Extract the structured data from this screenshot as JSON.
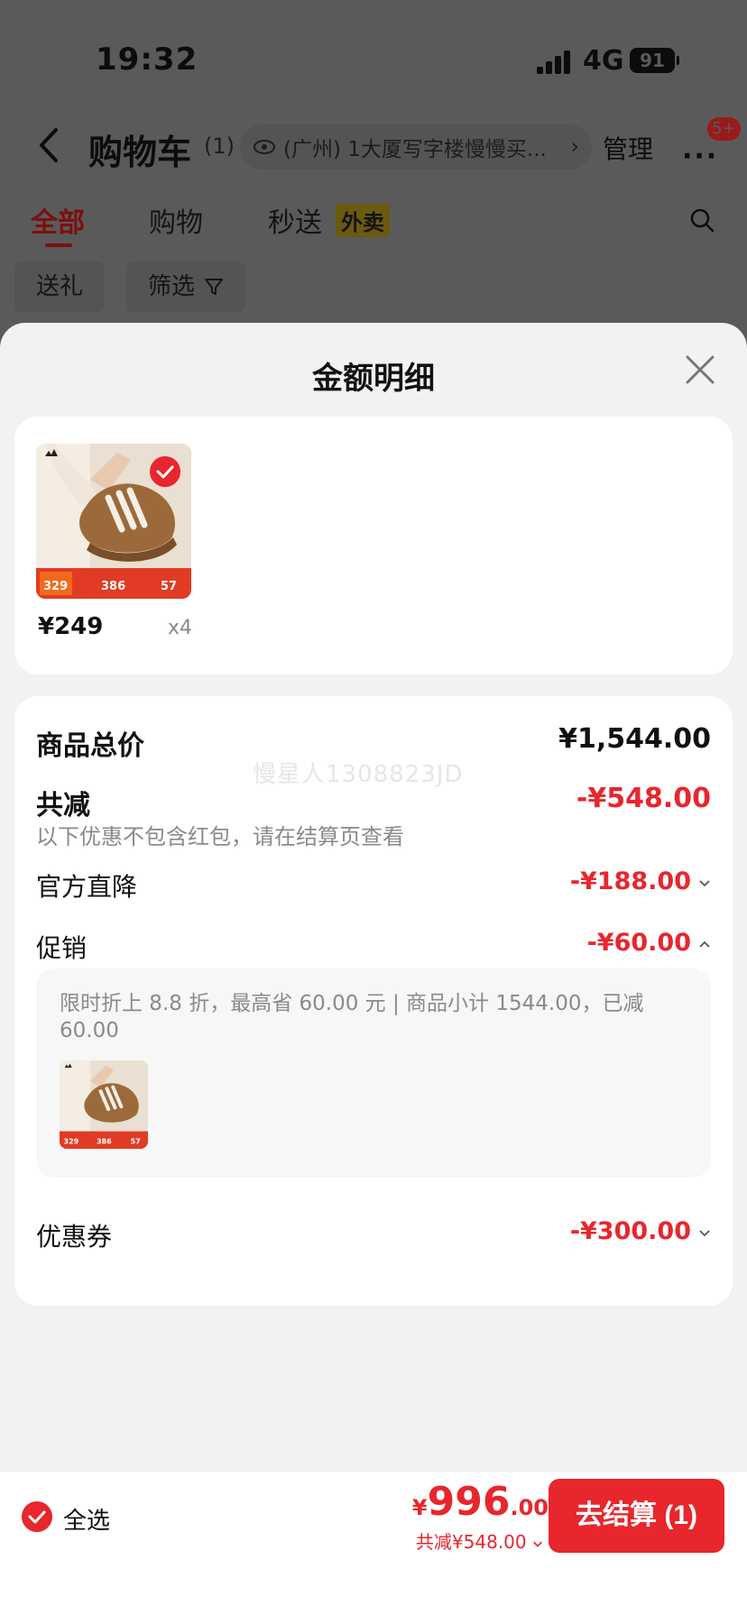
{
  "status_bar": {
    "time": "19:32",
    "network": "4G",
    "battery": "91"
  },
  "nav": {
    "back_icon": "chevron-left-icon",
    "title": "购物车",
    "count": "(1)",
    "address": "(广州) 1大厦写字楼慢慢买...",
    "manage_label": "管理",
    "more_icon": "more-dots-icon",
    "badge": "5+"
  },
  "tabs": [
    {
      "label": "全部",
      "active": true
    },
    {
      "label": "购物",
      "active": false
    },
    {
      "label": "秒送",
      "active": false
    }
  ],
  "tab_tag": "外卖",
  "chips": [
    {
      "label": "送礼"
    },
    {
      "label": "筛选"
    }
  ],
  "sheet": {
    "title": "金额明细",
    "close_icon": "close-icon",
    "product": {
      "price": "¥249",
      "quantity": "x4",
      "selected": true
    },
    "watermark": "慢星人1308823JD",
    "total_label": "商品总价",
    "total_value": "¥1,544.00",
    "reduction_label": "共减",
    "reduction_value": "-¥548.00",
    "reduction_note": "以下优惠不包含红包，请在结算页查看",
    "items": [
      {
        "label": "官方直降",
        "value": "-¥188.00",
        "expanded": false
      },
      {
        "label": "促销",
        "value": "-¥60.00",
        "expanded": true
      },
      {
        "label": "优惠券",
        "value": "-¥300.00",
        "expanded": false
      }
    ],
    "promo_text": "限时折上 8.8 折，最高省 60.00 元 | 商品小计 1544.00，已减 60.00"
  },
  "action_bar": {
    "select_all_label": "全选",
    "currency": "¥",
    "price_int": "996",
    "price_dec": ".00",
    "saved_text": "共减¥548.00",
    "checkout_label": "去结算 (1)"
  },
  "colors": {
    "accent": "#e8262d",
    "sheet_bg": "#f2f2f2",
    "overlay": "#5a5a5a"
  }
}
